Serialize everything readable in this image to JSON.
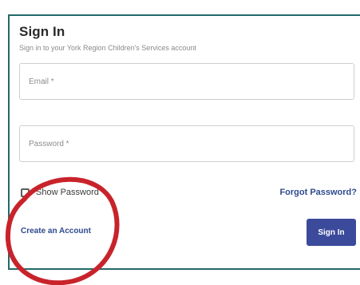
{
  "form": {
    "title": "Sign In",
    "subtitle": "Sign in to your York Region Children's Services account",
    "email_placeholder": "Email *",
    "password_placeholder": "Password *",
    "show_password_label": "Show Password",
    "forgot_password_label": "Forgot Password?",
    "create_account_label": "Create an Account",
    "signin_button_label": "Sign In"
  },
  "colors": {
    "card_border": "#23696a",
    "link": "#2e4a8e",
    "primary_button": "#3c4a9b",
    "annotation_circle": "#c8232b"
  }
}
